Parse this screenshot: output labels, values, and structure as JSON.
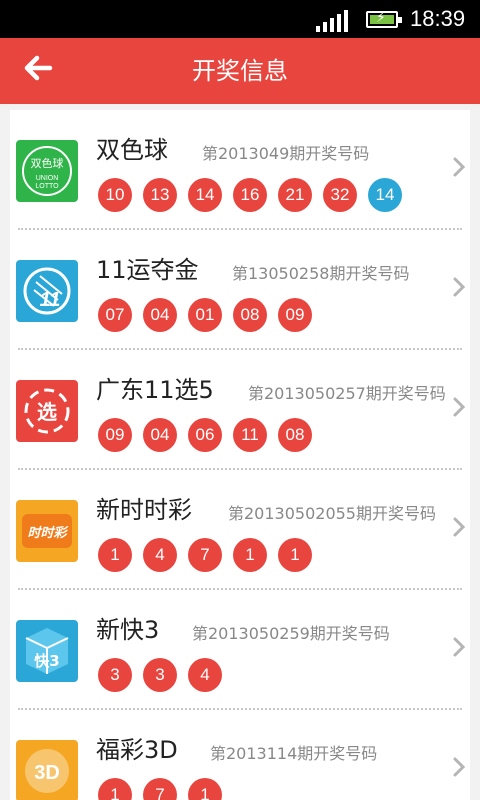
{
  "status": {
    "time": "18:39"
  },
  "header": {
    "title": "开奖信息"
  },
  "lotteries": [
    {
      "name": "双色球",
      "issue": "第2013049期开奖号码",
      "logo_text": "双色球",
      "red": [
        "10",
        "13",
        "14",
        "16",
        "21",
        "32"
      ],
      "blue": [
        "14"
      ]
    },
    {
      "name": "11运夺金",
      "issue": "第13050258期开奖号码",
      "logo_text": "11",
      "red": [
        "07",
        "04",
        "01",
        "08",
        "09"
      ],
      "blue": []
    },
    {
      "name": "广东11选5",
      "issue": "第2013050257期开奖号码",
      "logo_text": "选",
      "red": [
        "09",
        "04",
        "06",
        "11",
        "08"
      ],
      "blue": []
    },
    {
      "name": "新时时彩",
      "issue": "第20130502055期开奖号码",
      "logo_text": "时时彩",
      "red": [
        "1",
        "4",
        "7",
        "1",
        "1"
      ],
      "blue": []
    },
    {
      "name": "新快3",
      "issue": "第2013050259期开奖号码",
      "logo_text": "快3",
      "red": [
        "3",
        "3",
        "4"
      ],
      "blue": []
    },
    {
      "name": "福彩3D",
      "issue": "第2013114期开奖号码",
      "logo_text": "3D",
      "red": [
        "1",
        "7",
        "1"
      ],
      "blue": []
    }
  ],
  "colors": {
    "header": "#e8453f",
    "red_ball": "#e8453f",
    "blue_ball": "#2aa7d6"
  }
}
